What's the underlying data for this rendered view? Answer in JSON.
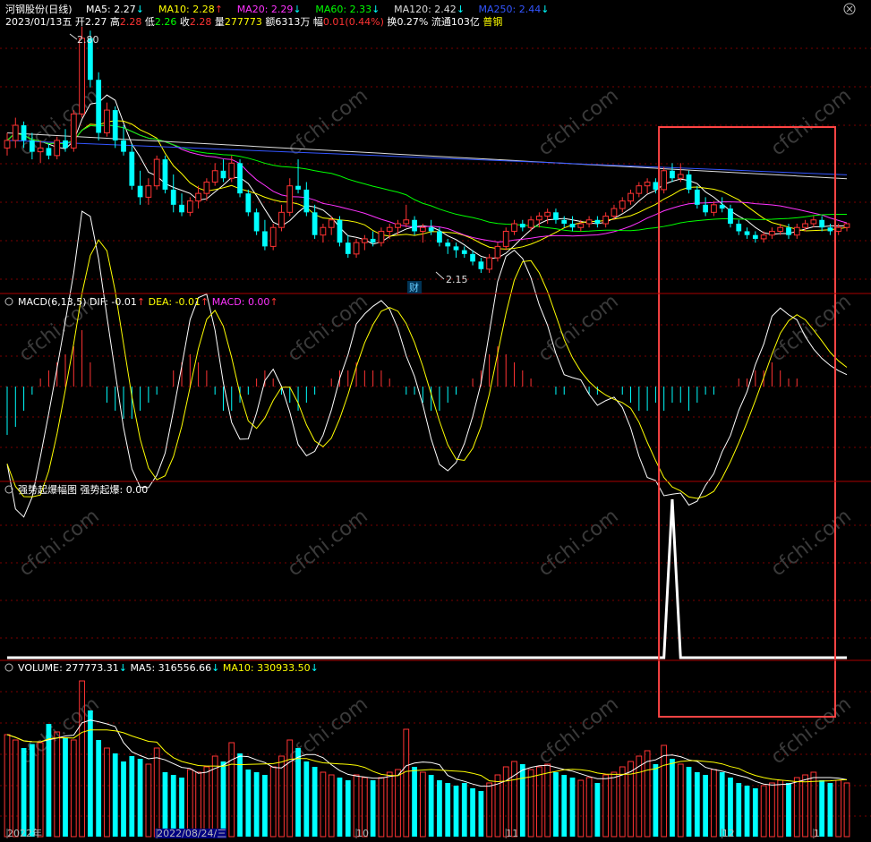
{
  "header": {
    "title": "河钢股份(日线)",
    "ma_items": [
      {
        "label": "MA5: 2.27",
        "arrow": "↓",
        "color": "#ffffff",
        "arrow_color": "#00ffff"
      },
      {
        "label": "MA10: 2.28",
        "arrow": "↑",
        "color": "#ffff00",
        "arrow_color": "#ff3333"
      },
      {
        "label": "MA20: 2.29",
        "arrow": "↓",
        "color": "#ff33ff",
        "arrow_color": "#00ffff"
      },
      {
        "label": "MA60: 2.33",
        "arrow": "↓",
        "color": "#00ff00",
        "arrow_color": "#00ffff"
      },
      {
        "label": "MA120: 2.42",
        "arrow": "↓",
        "color": "#dddddd",
        "arrow_color": "#00ffff"
      },
      {
        "label": "MA250: 2.44",
        "arrow": "↓",
        "color": "#3355ff",
        "arrow_color": "#00ffff"
      }
    ],
    "quote": {
      "date": "2023/01/13五",
      "open_label": "开",
      "open": "2.27",
      "high_label": "高",
      "high": "2.28",
      "low_label": "低",
      "low": "2.26",
      "close_label": "收",
      "close": "2.28",
      "vol_label": "量",
      "vol": "277773",
      "amount_label": "额",
      "amount": "6313万",
      "chg_label": "幅",
      "chg": "0.01(0.44%)",
      "turnover_label": "换",
      "turnover": "0.27%",
      "float_label": "流通",
      "float": "103亿",
      "sector": "普钢"
    },
    "close_icon": "close-circle-icon"
  },
  "macd_panel": {
    "title": "MACD(6,13,5)",
    "dif": "DIF: -0.01",
    "dif_arrow": "↑",
    "dea": "DEA: -0.01",
    "dea_arrow": "↑",
    "macd": "MACD: 0.00",
    "macd_arrow": "↑"
  },
  "strong_panel": {
    "title": "强势起爆幅图",
    "value": "强势起爆: 0.00"
  },
  "volume_panel": {
    "title": "VOLUME: 277773.31",
    "title_arrow": "↓",
    "ma5": "MA5: 316556.66",
    "ma5_arrow": "↓",
    "ma10": "MA10: 330933.50",
    "ma10_arrow": "↓"
  },
  "x_axis": {
    "labels": [
      "2022年",
      "2022/08/24/三",
      "10",
      "11",
      "12",
      "1"
    ]
  },
  "annotations": {
    "high_mark": "2.80",
    "low_mark": "2.15",
    "cai_badge": "财"
  },
  "watermark": "cfchi.com",
  "colors": {
    "up": "#ff3333",
    "down": "#00ffff",
    "ma5": "#ffffff",
    "ma10": "#ffff00",
    "ma20": "#ff33ff",
    "ma60": "#00ff00",
    "ma120": "#dddddd",
    "ma250": "#3355ff",
    "highlight_box": "#ff4444",
    "grid": "#7a0000"
  },
  "chart_data": {
    "type": "candlestick",
    "price_range": [
      2.15,
      2.8
    ],
    "candles": [
      [
        2.48,
        2.52,
        2.46,
        2.5
      ],
      [
        2.5,
        2.56,
        2.48,
        2.54
      ],
      [
        2.54,
        2.55,
        2.48,
        2.5
      ],
      [
        2.5,
        2.52,
        2.45,
        2.47
      ],
      [
        2.47,
        2.5,
        2.44,
        2.48
      ],
      [
        2.48,
        2.49,
        2.45,
        2.46
      ],
      [
        2.46,
        2.51,
        2.45,
        2.5
      ],
      [
        2.5,
        2.53,
        2.47,
        2.48
      ],
      [
        2.48,
        2.58,
        2.47,
        2.57
      ],
      [
        2.57,
        2.8,
        2.56,
        2.77
      ],
      [
        2.77,
        2.79,
        2.64,
        2.66
      ],
      [
        2.66,
        2.68,
        2.5,
        2.52
      ],
      [
        2.52,
        2.6,
        2.51,
        2.58
      ],
      [
        2.58,
        2.59,
        2.48,
        2.5
      ],
      [
        2.5,
        2.54,
        2.46,
        2.47
      ],
      [
        2.47,
        2.49,
        2.37,
        2.38
      ],
      [
        2.38,
        2.42,
        2.33,
        2.35
      ],
      [
        2.35,
        2.4,
        2.33,
        2.38
      ],
      [
        2.38,
        2.46,
        2.37,
        2.45
      ],
      [
        2.45,
        2.46,
        2.36,
        2.37
      ],
      [
        2.37,
        2.41,
        2.31,
        2.33
      ],
      [
        2.33,
        2.36,
        2.3,
        2.31
      ],
      [
        2.31,
        2.35,
        2.3,
        2.34
      ],
      [
        2.34,
        2.38,
        2.32,
        2.36
      ],
      [
        2.36,
        2.4,
        2.34,
        2.39
      ],
      [
        2.39,
        2.44,
        2.38,
        2.42
      ],
      [
        2.42,
        2.45,
        2.39,
        2.4
      ],
      [
        2.4,
        2.46,
        2.39,
        2.44
      ],
      [
        2.44,
        2.45,
        2.35,
        2.36
      ],
      [
        2.36,
        2.37,
        2.3,
        2.31
      ],
      [
        2.31,
        2.32,
        2.25,
        2.26
      ],
      [
        2.26,
        2.29,
        2.21,
        2.22
      ],
      [
        2.22,
        2.28,
        2.21,
        2.27
      ],
      [
        2.27,
        2.33,
        2.26,
        2.31
      ],
      [
        2.31,
        2.4,
        2.3,
        2.38
      ],
      [
        2.38,
        2.45,
        2.36,
        2.37
      ],
      [
        2.37,
        2.39,
        2.3,
        2.31
      ],
      [
        2.31,
        2.33,
        2.24,
        2.25
      ],
      [
        2.25,
        2.28,
        2.23,
        2.27
      ],
      [
        2.27,
        2.3,
        2.25,
        2.29
      ],
      [
        2.29,
        2.3,
        2.22,
        2.23
      ],
      [
        2.23,
        2.25,
        2.19,
        2.2
      ],
      [
        2.2,
        2.24,
        2.19,
        2.23
      ],
      [
        2.23,
        2.25,
        2.21,
        2.24
      ],
      [
        2.24,
        2.26,
        2.22,
        2.23
      ],
      [
        2.23,
        2.27,
        2.22,
        2.26
      ],
      [
        2.26,
        2.28,
        2.24,
        2.27
      ],
      [
        2.27,
        2.29,
        2.25,
        2.28
      ],
      [
        2.28,
        2.33,
        2.27,
        2.29
      ],
      [
        2.29,
        2.3,
        2.25,
        2.26
      ],
      [
        2.26,
        2.28,
        2.23,
        2.27
      ],
      [
        2.27,
        2.29,
        2.25,
        2.26
      ],
      [
        2.26,
        2.27,
        2.22,
        2.23
      ],
      [
        2.23,
        2.24,
        2.2,
        2.22
      ],
      [
        2.22,
        2.23,
        2.19,
        2.21
      ],
      [
        2.21,
        2.22,
        2.19,
        2.2
      ],
      [
        2.2,
        2.21,
        2.17,
        2.18
      ],
      [
        2.18,
        2.19,
        2.15,
        2.16
      ],
      [
        2.16,
        2.2,
        2.15,
        2.19
      ],
      [
        2.19,
        2.23,
        2.18,
        2.22
      ],
      [
        2.22,
        2.27,
        2.21,
        2.26
      ],
      [
        2.26,
        2.29,
        2.25,
        2.28
      ],
      [
        2.28,
        2.29,
        2.26,
        2.27
      ],
      [
        2.27,
        2.3,
        2.26,
        2.29
      ],
      [
        2.29,
        2.31,
        2.27,
        2.3
      ],
      [
        2.3,
        2.32,
        2.28,
        2.31
      ],
      [
        2.31,
        2.32,
        2.28,
        2.29
      ],
      [
        2.29,
        2.3,
        2.27,
        2.28
      ],
      [
        2.28,
        2.3,
        2.26,
        2.27
      ],
      [
        2.27,
        2.29,
        2.26,
        2.28
      ],
      [
        2.28,
        2.3,
        2.27,
        2.29
      ],
      [
        2.29,
        2.3,
        2.27,
        2.28
      ],
      [
        2.28,
        2.31,
        2.27,
        2.3
      ],
      [
        2.3,
        2.33,
        2.29,
        2.32
      ],
      [
        2.32,
        2.35,
        2.31,
        2.34
      ],
      [
        2.34,
        2.37,
        2.33,
        2.36
      ],
      [
        2.36,
        2.39,
        2.35,
        2.38
      ],
      [
        2.38,
        2.4,
        2.36,
        2.39
      ],
      [
        2.39,
        2.4,
        2.36,
        2.37
      ],
      [
        2.37,
        2.43,
        2.36,
        2.42
      ],
      [
        2.42,
        2.44,
        2.39,
        2.4
      ],
      [
        2.4,
        2.44,
        2.39,
        2.41
      ],
      [
        2.41,
        2.42,
        2.36,
        2.37
      ],
      [
        2.37,
        2.38,
        2.32,
        2.33
      ],
      [
        2.33,
        2.35,
        2.3,
        2.31
      ],
      [
        2.31,
        2.34,
        2.3,
        2.33
      ],
      [
        2.33,
        2.35,
        2.31,
        2.32
      ],
      [
        2.32,
        2.33,
        2.27,
        2.28
      ],
      [
        2.28,
        2.29,
        2.25,
        2.26
      ],
      [
        2.26,
        2.27,
        2.24,
        2.25
      ],
      [
        2.25,
        2.26,
        2.23,
        2.24
      ],
      [
        2.24,
        2.26,
        2.23,
        2.25
      ],
      [
        2.25,
        2.27,
        2.24,
        2.26
      ],
      [
        2.26,
        2.28,
        2.25,
        2.27
      ],
      [
        2.27,
        2.28,
        2.24,
        2.25
      ],
      [
        2.25,
        2.28,
        2.24,
        2.27
      ],
      [
        2.27,
        2.29,
        2.26,
        2.28
      ],
      [
        2.28,
        2.3,
        2.27,
        2.29
      ],
      [
        2.29,
        2.3,
        2.26,
        2.27
      ],
      [
        2.27,
        2.28,
        2.25,
        2.26
      ],
      [
        2.26,
        2.28,
        2.25,
        2.27
      ],
      [
        2.27,
        2.28,
        2.26,
        2.28
      ]
    ],
    "volume": [
      380000,
      360000,
      330000,
      345000,
      350000,
      420000,
      390000,
      370000,
      360000,
      580000,
      470000,
      360000,
      330000,
      310000,
      280000,
      300000,
      290000,
      270000,
      330000,
      240000,
      230000,
      220000,
      250000,
      240000,
      260000,
      300000,
      280000,
      350000,
      310000,
      250000,
      240000,
      230000,
      260000,
      300000,
      360000,
      330000,
      280000,
      260000,
      240000,
      230000,
      220000,
      210000,
      230000,
      220000,
      210000,
      220000,
      240000,
      250000,
      400000,
      260000,
      240000,
      230000,
      210000,
      200000,
      190000,
      200000,
      180000,
      170000,
      200000,
      230000,
      260000,
      280000,
      270000,
      250000,
      260000,
      270000,
      240000,
      230000,
      220000,
      210000,
      220000,
      200000,
      230000,
      240000,
      260000,
      280000,
      300000,
      320000,
      270000,
      340000,
      290000,
      270000,
      260000,
      240000,
      230000,
      250000,
      240000,
      220000,
      200000,
      190000,
      180000,
      190000,
      200000,
      210000,
      200000,
      220000,
      230000,
      240000,
      210000,
      200000,
      210000,
      200000
    ],
    "macd_hist": [
      -0.06,
      -0.05,
      -0.03,
      -0.01,
      0.01,
      0.02,
      0.03,
      0.04,
      0.05,
      0.07,
      0.03,
      0.0,
      -0.02,
      -0.03,
      -0.04,
      -0.04,
      -0.03,
      -0.02,
      -0.01,
      0.0,
      0.02,
      0.03,
      0.04,
      0.03,
      0.02,
      -0.01,
      -0.03,
      -0.03,
      -0.02,
      -0.01,
      0.01,
      0.02,
      0.01,
      -0.01,
      -0.02,
      -0.03,
      -0.02,
      -0.01,
      0.0,
      0.01,
      0.02,
      0.02,
      0.03,
      0.02,
      0.02,
      0.02,
      0.01,
      0.0,
      -0.01,
      -0.01,
      -0.02,
      -0.03,
      -0.03,
      -0.02,
      -0.01,
      0.0,
      0.01,
      0.02,
      0.04,
      0.05,
      0.04,
      0.03,
      0.02,
      0.01,
      0.0,
      0.0,
      -0.01,
      -0.01,
      0.0,
      0.0,
      -0.01,
      -0.01,
      0.0,
      0.0,
      -0.01,
      -0.02,
      -0.03,
      -0.03,
      -0.02,
      -0.03,
      -0.02,
      -0.02,
      -0.03,
      -0.02,
      -0.01,
      -0.01,
      0.0,
      0.0,
      0.01,
      0.01,
      0.02,
      0.02,
      0.03,
      0.02,
      0.01,
      0.01,
      0.0,
      0.0,
      0.0,
      0.0,
      0.0,
      0.0
    ],
    "strong_series_peak_index": 80,
    "highlight_range": [
      79,
      99
    ],
    "x_tick_indices": [
      0,
      18,
      42,
      60,
      86,
      97
    ]
  }
}
